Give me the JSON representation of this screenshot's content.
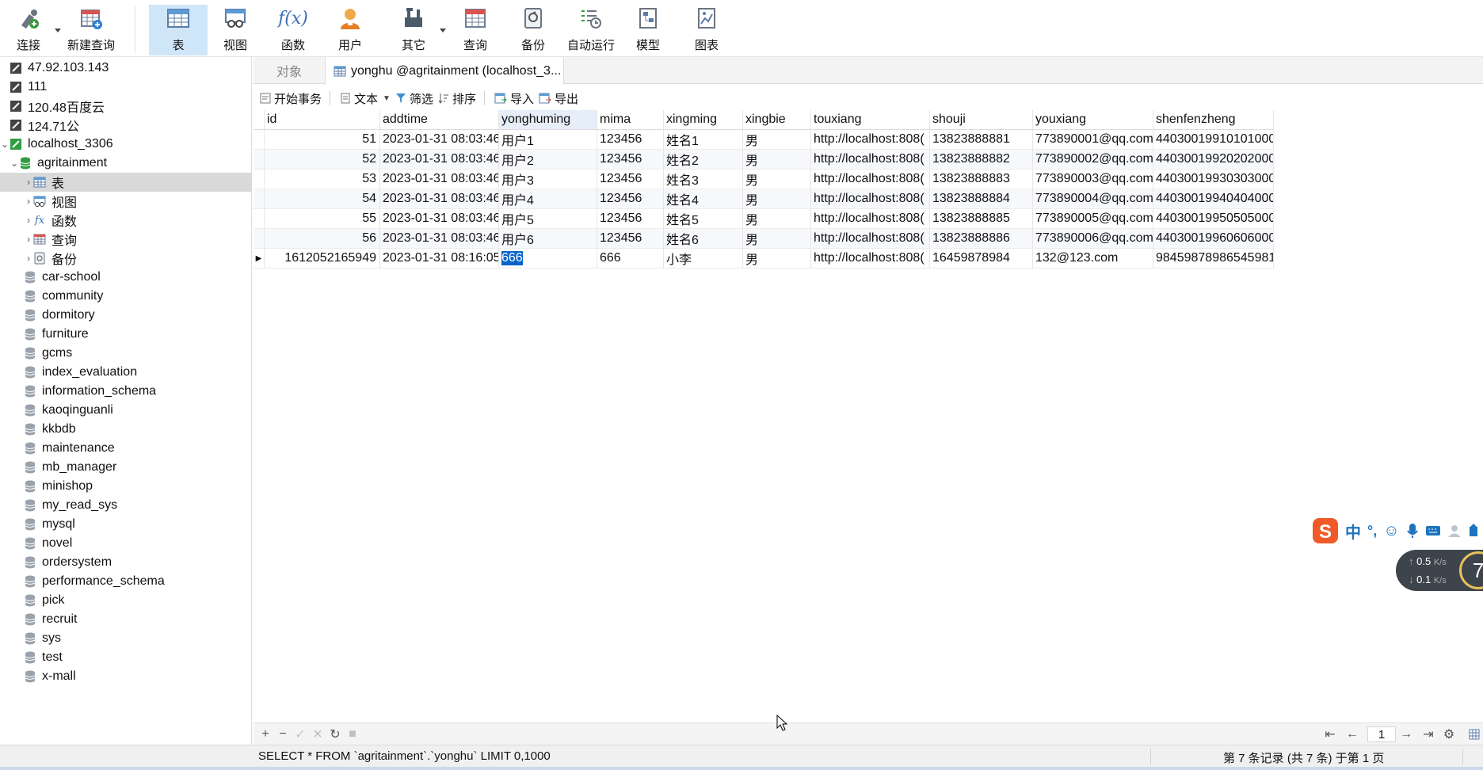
{
  "toolbar": {
    "buttons": [
      {
        "label": "连接",
        "icon": "connection-icon"
      },
      {
        "label": "新建查询",
        "icon": "new-query-icon"
      },
      {
        "label": "表",
        "icon": "table-icon"
      },
      {
        "label": "视图",
        "icon": "view-icon"
      },
      {
        "label": "函数",
        "icon": "function-icon"
      },
      {
        "label": "用户",
        "icon": "user-icon"
      },
      {
        "label": "其它",
        "icon": "tools-icon"
      },
      {
        "label": "查询",
        "icon": "query-icon"
      },
      {
        "label": "备份",
        "icon": "backup-icon"
      },
      {
        "label": "自动运行",
        "icon": "schedule-icon"
      },
      {
        "label": "模型",
        "icon": "model-icon"
      },
      {
        "label": "图表",
        "icon": "chart-icon"
      }
    ],
    "active": "表"
  },
  "tree": {
    "connections": [
      "47.92.103.143",
      "111",
      "120.48百度云",
      "124.71公"
    ],
    "localhost": "localhost_3306",
    "open_db": "agritainment",
    "open_db_children": [
      "表",
      "视图",
      "函数",
      "查询",
      "备份"
    ],
    "databases": [
      "car-school",
      "community",
      "dormitory",
      "furniture",
      "gcms",
      "index_evaluation",
      "information_schema",
      "kaoqinguanli",
      "kkbdb",
      "maintenance",
      "mb_manager",
      "minishop",
      "my_read_sys",
      "mysql",
      "novel",
      "ordersystem",
      "performance_schema",
      "pick",
      "recruit",
      "sys",
      "test",
      "x-mall"
    ]
  },
  "tabs": {
    "objects": "对象",
    "active": "yonghu @agritainment (localhost_3..."
  },
  "subtoolbar": {
    "begin_tx": "开始事务",
    "text": "文本",
    "filter": "筛选",
    "sort": "排序",
    "import": "导入",
    "export": "导出"
  },
  "grid": {
    "columns": [
      "id",
      "addtime",
      "yonghuming",
      "mima",
      "xingming",
      "xingbie",
      "touxiang",
      "shouji",
      "youxiang",
      "shenfenzheng"
    ],
    "rows": [
      [
        "51",
        "2023-01-31 08:03:46",
        "用户1",
        "123456",
        "姓名1",
        "男",
        "http://localhost:808(",
        "13823888881",
        "773890001@qq.com",
        "44030019910101000"
      ],
      [
        "52",
        "2023-01-31 08:03:46",
        "用户2",
        "123456",
        "姓名2",
        "男",
        "http://localhost:808(",
        "13823888882",
        "773890002@qq.com",
        "44030019920202000"
      ],
      [
        "53",
        "2023-01-31 08:03:46",
        "用户3",
        "123456",
        "姓名3",
        "男",
        "http://localhost:808(",
        "13823888883",
        "773890003@qq.com",
        "44030019930303000"
      ],
      [
        "54",
        "2023-01-31 08:03:46",
        "用户4",
        "123456",
        "姓名4",
        "男",
        "http://localhost:808(",
        "13823888884",
        "773890004@qq.com",
        "44030019940404000"
      ],
      [
        "55",
        "2023-01-31 08:03:46",
        "用户5",
        "123456",
        "姓名5",
        "男",
        "http://localhost:808(",
        "13823888885",
        "773890005@qq.com",
        "44030019950505000"
      ],
      [
        "56",
        "2023-01-31 08:03:46",
        "用户6",
        "123456",
        "姓名6",
        "男",
        "http://localhost:808(",
        "13823888886",
        "773890006@qq.com",
        "44030019960606000"
      ],
      [
        "1612052165949",
        "2023-01-31 08:16:05",
        "666",
        "666",
        "小李",
        "男",
        "http://localhost:808(",
        "16459878984",
        "132@123.com",
        "98459878986545981"
      ]
    ],
    "selected_row": 6,
    "selected_column": "yonghuming"
  },
  "navbar": {
    "page": "1"
  },
  "status": {
    "sql": "SELECT * FROM `agritainment`.`yonghu` LIMIT 0,1000",
    "records": "第 7 条记录 (共 7 条) 于第 1 页"
  },
  "ime": {
    "lang": "中",
    "punct": "°,",
    "up_speed": "0.5",
    "down_speed": "0.1",
    "unit": "K/s",
    "badge": "7"
  }
}
